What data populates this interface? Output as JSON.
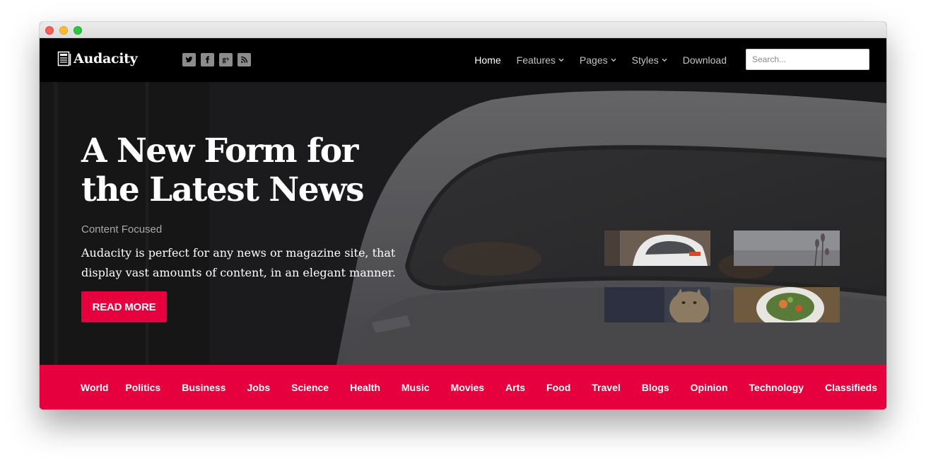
{
  "brand": {
    "name": "Audacity",
    "logo_icon": "newspaper-icon"
  },
  "social_icons": [
    "twitter-icon",
    "facebook-icon",
    "google-plus-icon",
    "rss-icon"
  ],
  "social_google_glyph": "g+",
  "nav": {
    "items": [
      {
        "label": "Home",
        "active": true,
        "dropdown": false
      },
      {
        "label": "Features",
        "active": false,
        "dropdown": true
      },
      {
        "label": "Pages",
        "active": false,
        "dropdown": true
      },
      {
        "label": "Styles",
        "active": false,
        "dropdown": true
      },
      {
        "label": "Download",
        "active": false,
        "dropdown": false
      }
    ]
  },
  "search": {
    "placeholder": "Search...",
    "value": ""
  },
  "hero": {
    "title_line1": "A New Form for",
    "title_line2": "the Latest News",
    "subtitle": "Content Focused",
    "description": "Audacity is perfect for any news or magazine site, that display vast amounts of content, in an elegant manner.",
    "cta_label": "READ MORE"
  },
  "thumbnails": [
    "car-thumbnail",
    "plant-thumbnail",
    "cat-thumbnail",
    "salad-thumbnail"
  ],
  "categories": [
    "World",
    "Politics",
    "Business",
    "Jobs",
    "Science",
    "Health",
    "Music",
    "Movies",
    "Arts",
    "Food",
    "Travel",
    "Blogs",
    "Opinion",
    "Technology",
    "Classifieds"
  ],
  "colors": {
    "accent": "#e6003e",
    "navbar_bg": "#000000",
    "menu_text": "#c3c3c3",
    "active_text": "#ffffff",
    "subtitle_text": "#a9a9a9"
  }
}
